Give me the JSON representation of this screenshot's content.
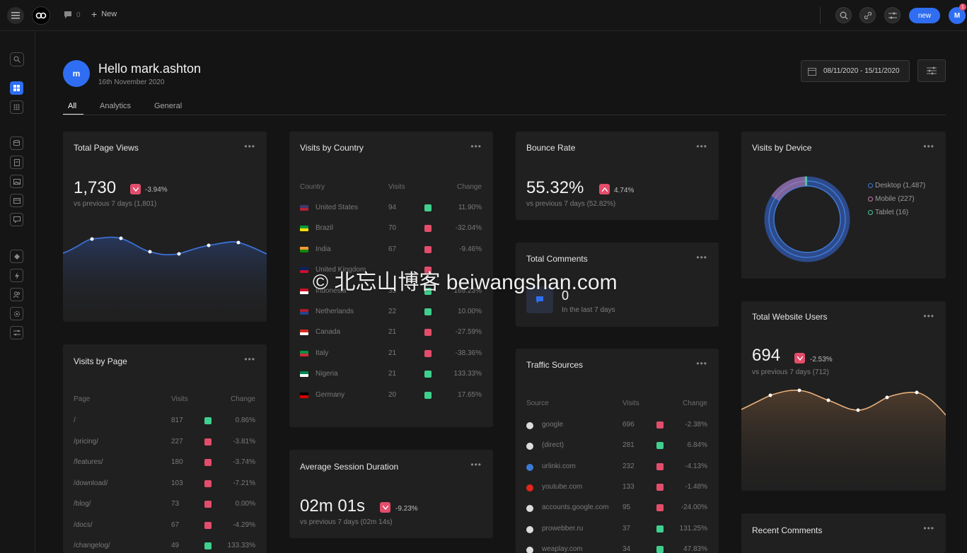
{
  "topbar": {
    "comment_count": "0",
    "new_label": "New",
    "new_button": "new",
    "avatar": "M",
    "notif": "1"
  },
  "header": {
    "avatar": "m",
    "greeting": "Hello mark.ashton",
    "date": "16th November 2020",
    "date_range": "08/11/2020 - 15/11/2020"
  },
  "tabs": [
    "All",
    "Analytics",
    "General"
  ],
  "total_page_views": {
    "title": "Total Page Views",
    "value": "1,730",
    "change": "-3.94%",
    "sub": "vs previous 7 days (1,801)"
  },
  "visits_by_country": {
    "title": "Visits by Country",
    "headers": [
      "Country",
      "Visits",
      "Change"
    ],
    "rows": [
      {
        "country": "United States",
        "visits": "94",
        "change": "11.90%",
        "up": true
      },
      {
        "country": "Brazil",
        "visits": "70",
        "change": "-32.04%",
        "up": false
      },
      {
        "country": "India",
        "visits": "67",
        "change": "-9.46%",
        "up": false
      },
      {
        "country": "United Kingdom",
        "visits": "",
        "change": "",
        "up": false
      },
      {
        "country": "Indonesia",
        "visits": "35",
        "change": "169.23%",
        "up": true
      },
      {
        "country": "Netherlands",
        "visits": "22",
        "change": "10.00%",
        "up": true
      },
      {
        "country": "Canada",
        "visits": "21",
        "change": "-27.59%",
        "up": false
      },
      {
        "country": "Italy",
        "visits": "21",
        "change": "-38.36%",
        "up": false
      },
      {
        "country": "Nigeria",
        "visits": "21",
        "change": "133.33%",
        "up": true
      },
      {
        "country": "Germany",
        "visits": "20",
        "change": "17.65%",
        "up": true
      }
    ]
  },
  "bounce_rate": {
    "title": "Bounce Rate",
    "value": "55.32%",
    "change": "4.74%",
    "sub": "vs previous 7 days (52.82%)"
  },
  "total_comments": {
    "title": "Total Comments",
    "value": "0",
    "sub": "In the last 7 days"
  },
  "visits_by_device": {
    "title": "Visits by Device",
    "legend": [
      "Desktop (1,487)",
      "Mobile (227)",
      "Tablet (16)"
    ],
    "colors": [
      "#3d7ad6",
      "#c27aa9",
      "#4ec7a4"
    ]
  },
  "total_website_users": {
    "title": "Total Website Users",
    "value": "694",
    "change": "-2.53%",
    "sub": "vs previous 7 days (712)"
  },
  "visits_by_page": {
    "title": "Visits by Page",
    "headers": [
      "Page",
      "Visits",
      "Change"
    ],
    "rows": [
      {
        "page": "/",
        "visits": "817",
        "change": "0.86%",
        "up": true
      },
      {
        "page": "/pricing/",
        "visits": "227",
        "change": "-3.81%",
        "up": false
      },
      {
        "page": "/features/",
        "visits": "180",
        "change": "-3.74%",
        "up": false
      },
      {
        "page": "/download/",
        "visits": "103",
        "change": "-7.21%",
        "up": false
      },
      {
        "page": "/blog/",
        "visits": "73",
        "change": "0.00%",
        "up": false
      },
      {
        "page": "/docs/",
        "visits": "67",
        "change": "-4.29%",
        "up": false
      },
      {
        "page": "/changelog/",
        "visits": "49",
        "change": "133.33%",
        "up": true
      }
    ]
  },
  "avg_session": {
    "title": "Average Session Duration",
    "value": "02m 01s",
    "change": "-9.23%",
    "sub": "vs previous 7 days (02m 14s)"
  },
  "traffic_sources": {
    "title": "Traffic Sources",
    "headers": [
      "Source",
      "Visits",
      "Change"
    ],
    "rows": [
      {
        "source": "google",
        "visits": "696",
        "change": "-2.38%",
        "up": false
      },
      {
        "source": "(direct)",
        "visits": "281",
        "change": "6.84%",
        "up": true
      },
      {
        "source": "urlinki.com",
        "visits": "232",
        "change": "-4.13%",
        "up": false
      },
      {
        "source": "youtube.com",
        "visits": "133",
        "change": "-1.48%",
        "up": false
      },
      {
        "source": "accounts.google.com",
        "visits": "95",
        "change": "-24.00%",
        "up": false
      },
      {
        "source": "prowebber.ru",
        "visits": "37",
        "change": "131.25%",
        "up": true
      },
      {
        "source": "weaplay.com",
        "visits": "34",
        "change": "47.83%",
        "up": true
      }
    ]
  },
  "recent_comments": {
    "title": "Recent Comments"
  },
  "watermark": "© 北忘山博客 beiwangshan.com"
}
